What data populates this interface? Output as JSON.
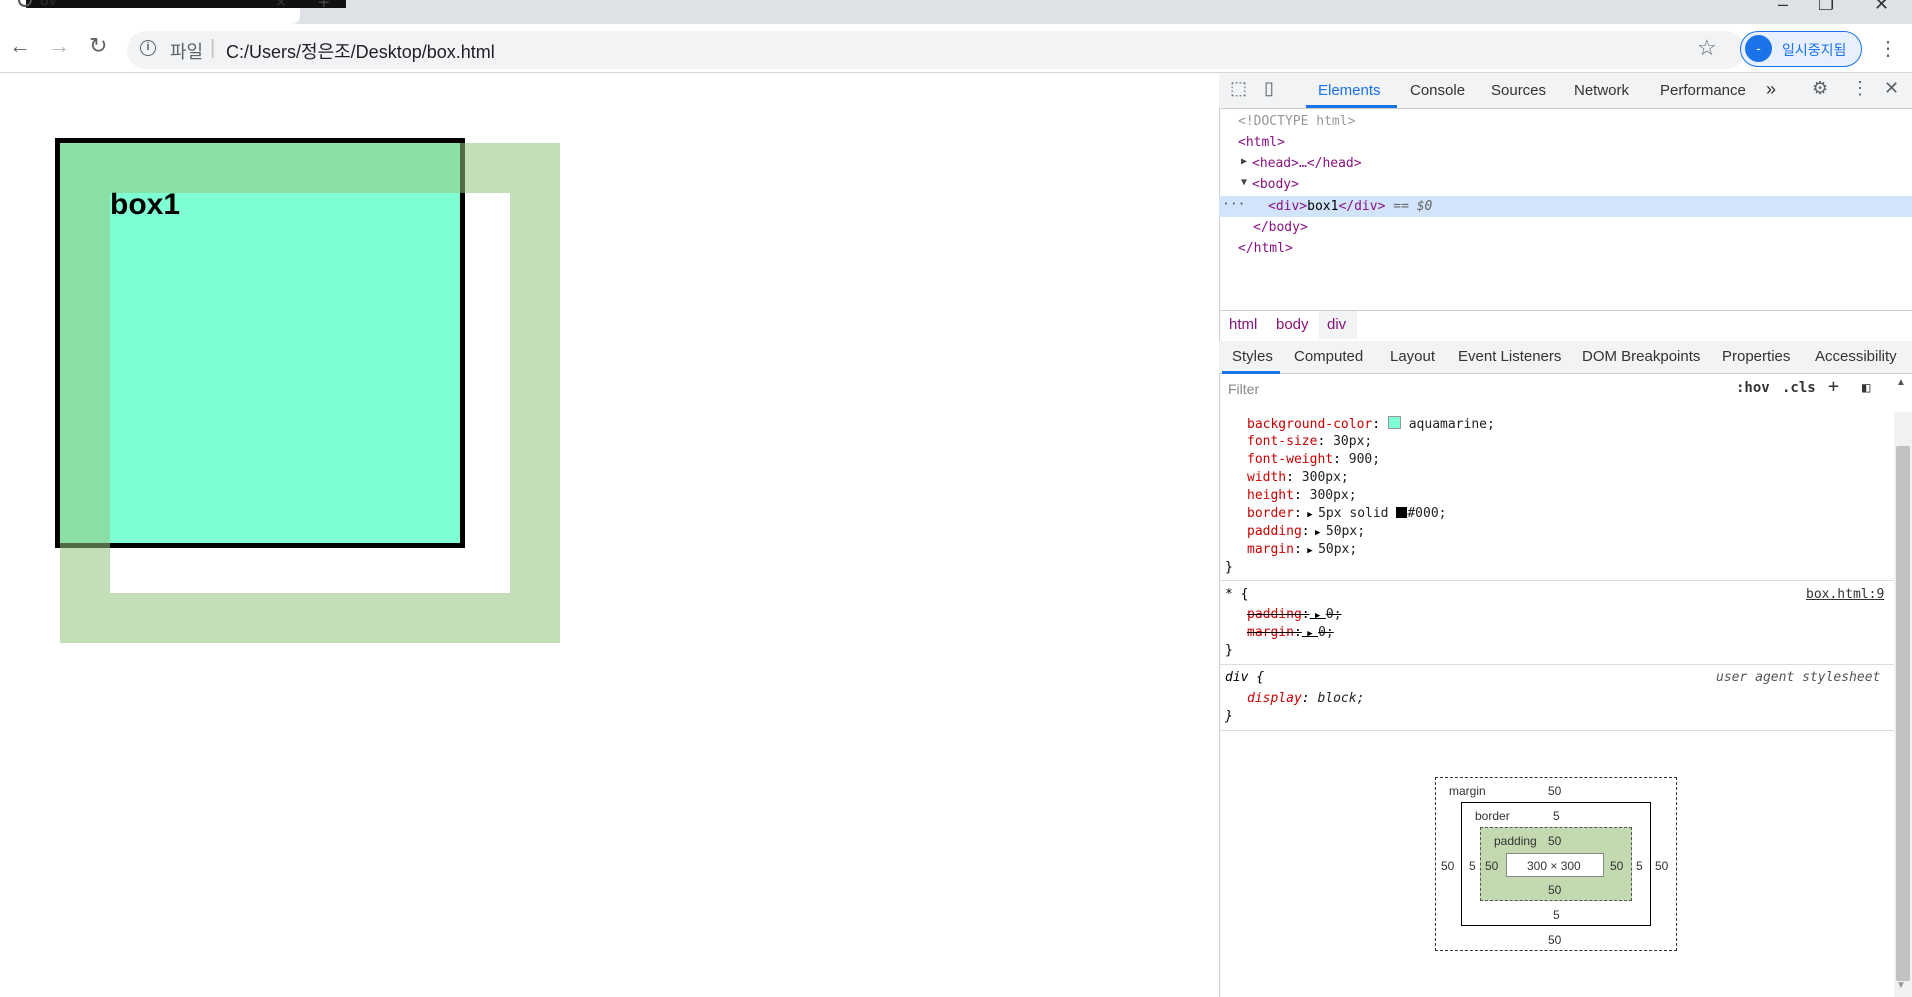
{
  "browser": {
    "tab_title": "UV",
    "address": {
      "scheme_label": "파일",
      "separator": "|",
      "url": "C:/Users/정은조/Desktop/box.html"
    },
    "profile_button_label": "일시중지됨"
  },
  "page": {
    "box_text": "box1"
  },
  "devtools": {
    "tabs": [
      "Elements",
      "Console",
      "Sources",
      "Network",
      "Performance"
    ],
    "more_tabs": "»",
    "dom": {
      "doctype": "<!DOCTYPE html>",
      "html_open": "<html>",
      "head_collapsed": "<head>…</head>",
      "body_open": "<body>",
      "div_open": "<div>",
      "div_text": "box1",
      "div_close": "</div>",
      "div_suffix": "== $0",
      "row_ellipsis": "···",
      "body_close": "</body>",
      "html_close": "</html>"
    },
    "breadcrumbs": [
      "html",
      "body",
      "div"
    ],
    "panel_tabs": [
      "Styles",
      "Computed",
      "Layout",
      "Event Listeners",
      "DOM Breakpoints",
      "Properties",
      "Accessibility"
    ],
    "filter_placeholder": "Filter",
    "filter_buttons": {
      "hov": ":hov",
      "cls": ".cls",
      "add": "+"
    },
    "rules": [
      {
        "declarations": [
          {
            "prop": "background-color",
            "value": "aquamarine;"
          },
          {
            "prop": "font-size",
            "value": "30px;"
          },
          {
            "prop": "font-weight",
            "value": "900;"
          },
          {
            "prop": "width",
            "value": "300px;"
          },
          {
            "prop": "height",
            "value": "300px;"
          },
          {
            "prop": "border",
            "value": "5px solid"
          },
          {
            "prop": "padding",
            "value": "50px;"
          },
          {
            "prop": "margin",
            "value": "50px;"
          }
        ],
        "border_color_value": "#000;",
        "close": "}"
      },
      {
        "selector": "* {",
        "source": "box.html:9",
        "declarations": [
          {
            "prop": "padding",
            "value": "0;"
          },
          {
            "prop": "margin",
            "value": "0;"
          }
        ],
        "close": "}"
      },
      {
        "selector": "div {",
        "source": "user agent stylesheet",
        "declarations": [
          {
            "prop": "display",
            "value": "block;"
          }
        ],
        "close": "}"
      }
    ],
    "box_model": {
      "margin_label": "margin",
      "border_label": "border",
      "padding_label": "padding",
      "margin_top": "50",
      "margin_bottom": "50",
      "margin_left": "50",
      "margin_right": "50",
      "border_top": "5",
      "border_bottom": "5",
      "border_left": "5",
      "border_right": "5",
      "padding_top": "50",
      "padding_bottom": "50",
      "padding_left": "50",
      "padding_right": "50",
      "content": "300 × 300"
    }
  },
  "colors": {
    "aquamarine": "#7fffd4",
    "margin_overlay": "#93c47d",
    "selection": "#d2e3fc",
    "accent": "#1a73e8"
  },
  "icons": {
    "back": "arrow-left-icon",
    "forward": "arrow-right-icon",
    "reload": "reload-icon",
    "info": "info-icon",
    "star": "star-icon",
    "menu": "kebab-menu-icon",
    "inspect": "inspect-element-icon",
    "device": "device-toolbar-icon",
    "settings": "gear-icon",
    "close": "close-icon"
  }
}
